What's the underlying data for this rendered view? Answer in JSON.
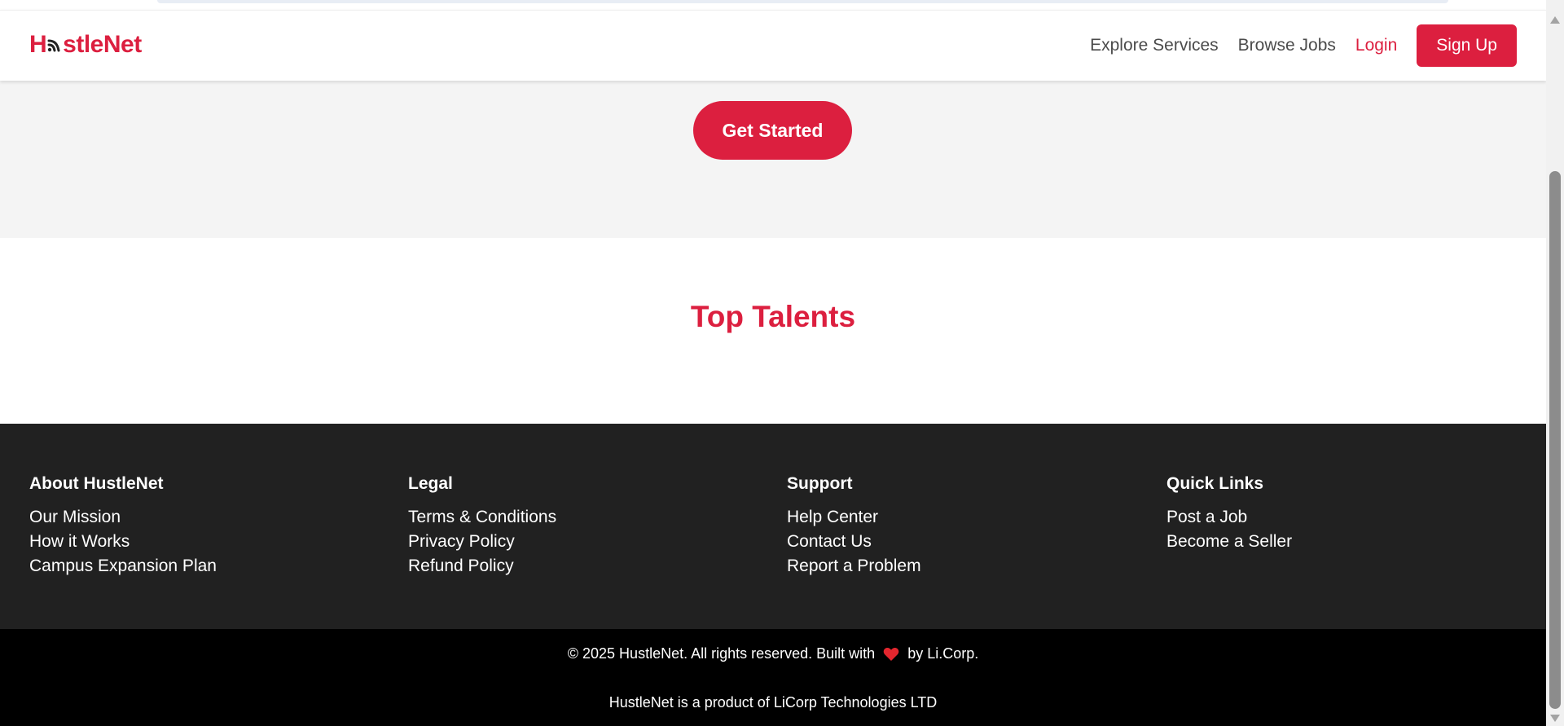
{
  "brand": {
    "name": "HustleNet",
    "color": "#dc1f3f"
  },
  "nav": {
    "explore": "Explore Services",
    "browse": "Browse Jobs",
    "login": "Login",
    "signup": "Sign Up"
  },
  "hero": {
    "cta": "Get Started"
  },
  "talents": {
    "title": "Top Talents"
  },
  "footer": {
    "columns": [
      {
        "heading": "About HustleNet",
        "links": [
          "Our Mission",
          "How it Works",
          "Campus Expansion Plan"
        ]
      },
      {
        "heading": "Legal",
        "links": [
          "Terms & Conditions",
          "Privacy Policy",
          "Refund Policy"
        ]
      },
      {
        "heading": "Support",
        "links": [
          "Help Center",
          "Contact Us",
          "Report a Problem"
        ]
      },
      {
        "heading": "Quick Links",
        "links": [
          "Post a Job",
          "Become a Seller"
        ]
      }
    ]
  },
  "bottom": {
    "copyright_pre": "© 2025 HustleNet. All rights reserved. Built with",
    "copyright_post": "by Li.Corp.",
    "product_line": "HustleNet is a product of LiCorp Technologies LTD",
    "heart_icon": "heart-icon"
  },
  "colors": {
    "accent": "#dc1f3f",
    "footer_bg": "#212121",
    "bottom_bg": "#000000",
    "hero_bg": "#f4f4f4"
  }
}
